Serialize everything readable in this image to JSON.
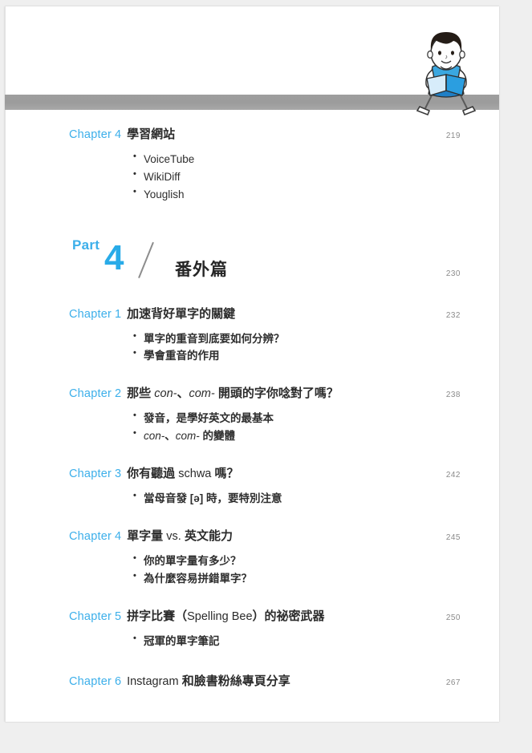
{
  "document": {
    "kind": "book-table-of-contents",
    "accent_blue": "#3cafea",
    "rule_gray": "#9c9c9c",
    "page_bg": "#ffffff",
    "canvas_bg": "#efefef"
  },
  "illustration": {
    "name": "boy-reading-book",
    "hair_color": "#2b2018",
    "skin_color": "#fdfdfd",
    "shirt_color": "#3aa7e0",
    "book_color": "#2b9ee0"
  },
  "top_rule": {
    "label": "horizontal-gray-rule"
  },
  "entries": [
    {
      "type": "chapter",
      "label": "Chapter",
      "number": "4",
      "title": "學習網站",
      "page": "219",
      "bullets": [
        {
          "text": "VoiceTube",
          "style": "latin"
        },
        {
          "text": "WikiDiff",
          "style": "latin"
        },
        {
          "text": "Youglish",
          "style": "latin"
        }
      ]
    },
    {
      "type": "part",
      "label": "Part",
      "number": "4",
      "title": "番外篇",
      "page": "230"
    },
    {
      "type": "chapter",
      "label": "Chapter",
      "number": "1",
      "title": "加速背好單字的關鍵",
      "page": "232",
      "bullets": [
        {
          "text": "單字的重音到底要如何分辨？",
          "style": "cjk"
        },
        {
          "text": "學會重音的作用",
          "style": "cjk"
        }
      ]
    },
    {
      "type": "chapter",
      "label": "Chapter",
      "number": "2",
      "title_parts": [
        {
          "text": "那些 ",
          "style": "cjk"
        },
        {
          "text": "con-",
          "style": "italic"
        },
        {
          "text": "、",
          "style": "cjk"
        },
        {
          "text": "com-",
          "style": "italic"
        },
        {
          "text": " 開頭的字你唸對了嗎？",
          "style": "cjk"
        }
      ],
      "title": "那些 con-、com- 開頭的字你唸對了嗎？",
      "page": "238",
      "bullets": [
        {
          "text": "發音，是學好英文的最基本",
          "style": "cjk"
        },
        {
          "style": "mixed",
          "text": "con-、com- 的變體",
          "parts": [
            {
              "text": "con-",
              "style": "italic"
            },
            {
              "text": "、",
              "style": "cjk"
            },
            {
              "text": "com-",
              "style": "italic"
            },
            {
              "text": " 的變體",
              "style": "cjk"
            }
          ]
        }
      ]
    },
    {
      "type": "chapter",
      "label": "Chapter",
      "number": "3",
      "title_parts": [
        {
          "text": "你有聽過 ",
          "style": "cjk"
        },
        {
          "text": "schwa",
          "style": "latin"
        },
        {
          "text": " 嗎？",
          "style": "cjk"
        }
      ],
      "title": "你有聽過 schwa 嗎？",
      "page": "242",
      "bullets": [
        {
          "text": "當母音發 [ə] 時，要特別注意",
          "style": "cjk"
        }
      ]
    },
    {
      "type": "chapter",
      "label": "Chapter",
      "number": "4",
      "title_parts": [
        {
          "text": "單字量 ",
          "style": "cjk"
        },
        {
          "text": "vs.",
          "style": "latin"
        },
        {
          "text": " 英文能力",
          "style": "cjk"
        }
      ],
      "title": "單字量 vs. 英文能力",
      "page": "245",
      "bullets": [
        {
          "text": "你的單字量有多少？",
          "style": "cjk"
        },
        {
          "text": "為什麼容易拼錯單字？",
          "style": "cjk"
        }
      ]
    },
    {
      "type": "chapter",
      "label": "Chapter",
      "number": "5",
      "title_parts": [
        {
          "text": "拼字比賽（",
          "style": "cjk"
        },
        {
          "text": "Spelling Bee",
          "style": "latin"
        },
        {
          "text": "）的祕密武器",
          "style": "cjk"
        }
      ],
      "title": "拼字比賽（Spelling Bee）的祕密武器",
      "page": "250",
      "bullets": [
        {
          "text": "冠軍的單字筆記",
          "style": "cjk"
        }
      ]
    },
    {
      "type": "chapter",
      "label": "Chapter",
      "number": "6",
      "title_parts": [
        {
          "text": "Instagram",
          "style": "latin"
        },
        {
          "text": " 和臉書粉絲專頁分享",
          "style": "cjk"
        }
      ],
      "title": "Instagram 和臉書粉絲專頁分享",
      "page": "267",
      "bullets": []
    }
  ]
}
